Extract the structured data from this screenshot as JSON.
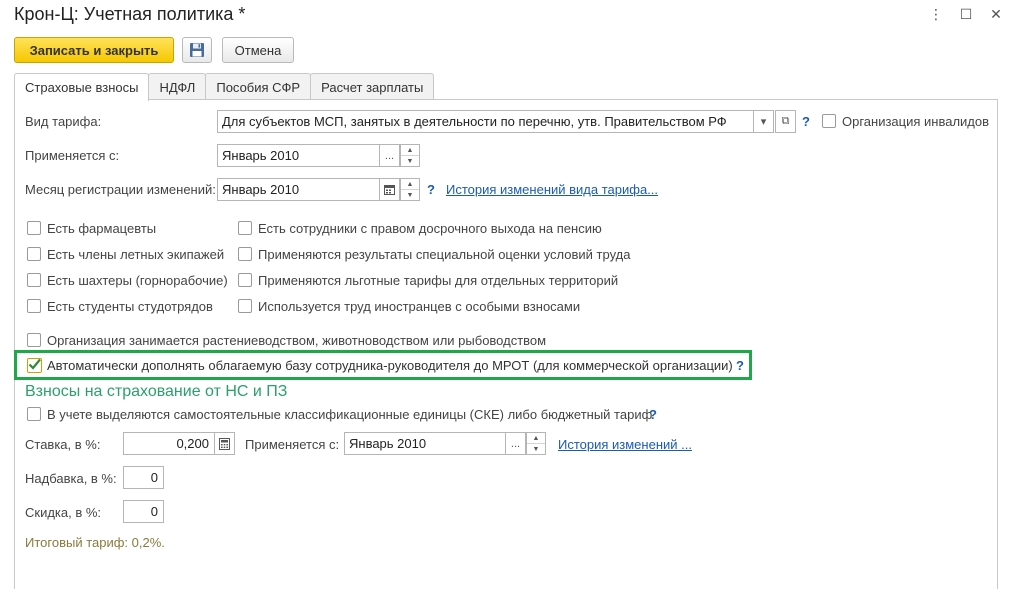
{
  "window": {
    "title": "Крон-Ц: Учетная политика *",
    "controls": [
      "⋮",
      "☐",
      "✕"
    ]
  },
  "toolbar": {
    "save_close": "Записать и закрыть",
    "save_icon": "floppy-disk-icon",
    "cancel": "Отмена"
  },
  "tabs": [
    {
      "label": "Страховые взносы",
      "active": true
    },
    {
      "label": "НДФЛ",
      "active": false
    },
    {
      "label": "Пособия СФР",
      "active": false
    },
    {
      "label": "Расчет зарплаты",
      "active": false
    }
  ],
  "form": {
    "tariff_label": "Вид тарифа:",
    "tariff_value": "Для субъектов МСП, занятых в деятельности по перечню, утв. Правительством РФ",
    "invalid_org_label": "Организация инвалидов",
    "applies_from_label": "Применяется с:",
    "applies_from_value": "Январь 2010",
    "reg_month_label": "Месяц регистрации изменений:",
    "reg_month_value": "Январь 2010",
    "tariff_history_link": "История изменений вида тарифа...",
    "help": "?",
    "ellipsis": "...",
    "left_checkboxes": [
      {
        "label": "Есть фармацевты",
        "checked": false
      },
      {
        "label": "Есть члены летных экипажей",
        "checked": false
      },
      {
        "label": "Есть шахтеры (горнорабочие)",
        "checked": false
      },
      {
        "label": "Есть студенты студотрядов",
        "checked": false
      }
    ],
    "right_checkboxes": [
      {
        "label": "Есть сотрудники с правом досрочного выхода на пенсию",
        "checked": false
      },
      {
        "label": "Применяются результаты специальной оценки условий труда",
        "checked": false
      },
      {
        "label": "Применяются льготные тарифы для отдельных территорий",
        "checked": false
      },
      {
        "label": "Используется труд иностранцев с особыми взносами",
        "checked": false
      }
    ],
    "agri_label": "Организация занимается растениеводством, животноводством или рыбоводством",
    "agri_checked": false,
    "mrot_label": "Автоматически дополнять облагаемую базу сотрудника-руководителя до МРОТ (для коммерческой организации)",
    "mrot_checked": true
  },
  "ns_section": {
    "title": "Взносы на страхование от НС и ПЗ",
    "ske_label": "В учете выделяются самостоятельные классификационные единицы (СКЕ) либо бюджетный тариф",
    "ske_checked": false,
    "rate_label": "Ставка, в %:",
    "rate_value": "0,200",
    "applies_from_label": "Применяется с:",
    "applies_from_value": "Январь 2010",
    "history_link": "История изменений ...",
    "surcharge_label": "Надбавка, в %:",
    "surcharge_value": "0",
    "discount_label": "Скидка, в %:",
    "discount_value": "0",
    "total": "Итоговый тариф: 0,2%."
  },
  "colors": {
    "primary_button": "#f5c800",
    "section_title": "#2aa06b",
    "highlight_border": "#1fa84a",
    "link": "#1a5bb5"
  }
}
